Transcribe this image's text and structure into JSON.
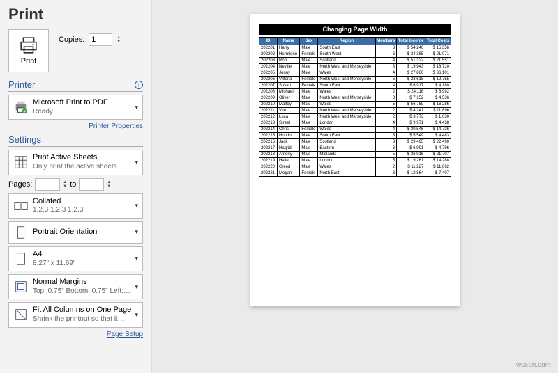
{
  "title": "Print",
  "print_btn": "Print",
  "copies_label": "Copies:",
  "copies_value": "1",
  "printer_section": "Printer",
  "printer": {
    "name": "Microsoft Print to PDF",
    "status": "Ready"
  },
  "printer_props_link": "Printer Properties",
  "settings_section": "Settings",
  "scope": {
    "t1": "Print Active Sheets",
    "t2": "Only print the active sheets"
  },
  "pages_label": "Pages:",
  "pages_to": "to",
  "collate": {
    "t1": "Collated",
    "t2": "1,2,3   1,2,3   1,2,3"
  },
  "orient": {
    "t1": "Portrait Orientation",
    "t2": ""
  },
  "paper": {
    "t1": "A4",
    "t2": "8.27\" x 11.69\""
  },
  "margins": {
    "t1": "Normal Margins",
    "t2": "Top: 0.75\" Bottom: 0.75\" Left:…"
  },
  "scaling": {
    "t1": "Fit All Columns on One Page",
    "t2": "Shrink the printout so that it…"
  },
  "page_setup_link": "Page Setup",
  "preview_title": "Changing Page Width",
  "cols": [
    "ID",
    "Name",
    "Sex",
    "Region",
    "Members",
    "Total Income",
    "Total Costs"
  ],
  "rows": [
    [
      "202201",
      "Harry",
      "Male",
      "South East",
      "3",
      "$   54,246",
      "$   15,356"
    ],
    [
      "202202",
      "Hermione",
      "Female",
      "South West",
      "6",
      "$   34,365",
      "$   21,071"
    ],
    [
      "202203",
      "Ron",
      "Male",
      "Scotland",
      "4",
      "$   51,122",
      "$   21,551"
    ],
    [
      "202204",
      "Neville",
      "Male",
      "North West and Merseyside",
      "3",
      "$   19,943",
      "$   16,710"
    ],
    [
      "202205",
      "Jonny",
      "Male",
      "Wales",
      "4",
      "$   27,860",
      "$   36,101"
    ],
    [
      "202206",
      "Vittoria",
      "Female",
      "North West and Merseyside",
      "5",
      "$   23,618",
      "$   12,755"
    ],
    [
      "202207",
      "Susan",
      "Female",
      "South East",
      "4",
      "$    6,917",
      "$    4,180"
    ],
    [
      "202208",
      "Michael",
      "Male",
      "Wales",
      "2",
      "$   24,116",
      "$    6,992"
    ],
    [
      "202209",
      "Oliver",
      "Male",
      "North West and Merseyside",
      "3",
      "$    7,152",
      "$    4,536"
    ],
    [
      "202210",
      "Malfoy",
      "Male",
      "Wales",
      "5",
      "$   56,759",
      "$   16,286"
    ],
    [
      "202211",
      "Vito",
      "Male",
      "North West and Merseyside",
      "2",
      "$    4,241",
      "$   11,896"
    ],
    [
      "202212",
      "Luca",
      "Male",
      "North West and Merseyside",
      "2",
      "$    3,773",
      "$    1,030"
    ],
    [
      "202213",
      "Street",
      "Male",
      "London",
      "4",
      "$    9,971",
      "$    4,438"
    ],
    [
      "202214",
      "Chris",
      "Female",
      "Wales",
      "4",
      "$   30,546",
      "$   14,736"
    ],
    [
      "202215",
      "Hondo",
      "Male",
      "South East",
      "3",
      "$    5,549",
      "$    4,483"
    ],
    [
      "202216",
      "Jack",
      "Male",
      "Scotland",
      "3",
      "$   29,495",
      "$   22,490"
    ],
    [
      "202217",
      "Hagrid",
      "Male",
      "Eastern",
      "3",
      "$    6,991",
      "$    4,796"
    ],
    [
      "202218",
      "Antony",
      "Male",
      "Midlands",
      "5",
      "$   36,916",
      "$   21,707"
    ],
    [
      "202219",
      "Halle",
      "Male",
      "London",
      "5",
      "$   19,261",
      "$   14,288"
    ],
    [
      "202220",
      "Creed",
      "Male",
      "Wales",
      "2",
      "$   11,227",
      "$   11,062"
    ],
    [
      "202221",
      "Megan",
      "Female",
      "North East",
      "3",
      "$   12,864",
      "$    7,407"
    ]
  ],
  "watermark": "wsxdn.com"
}
